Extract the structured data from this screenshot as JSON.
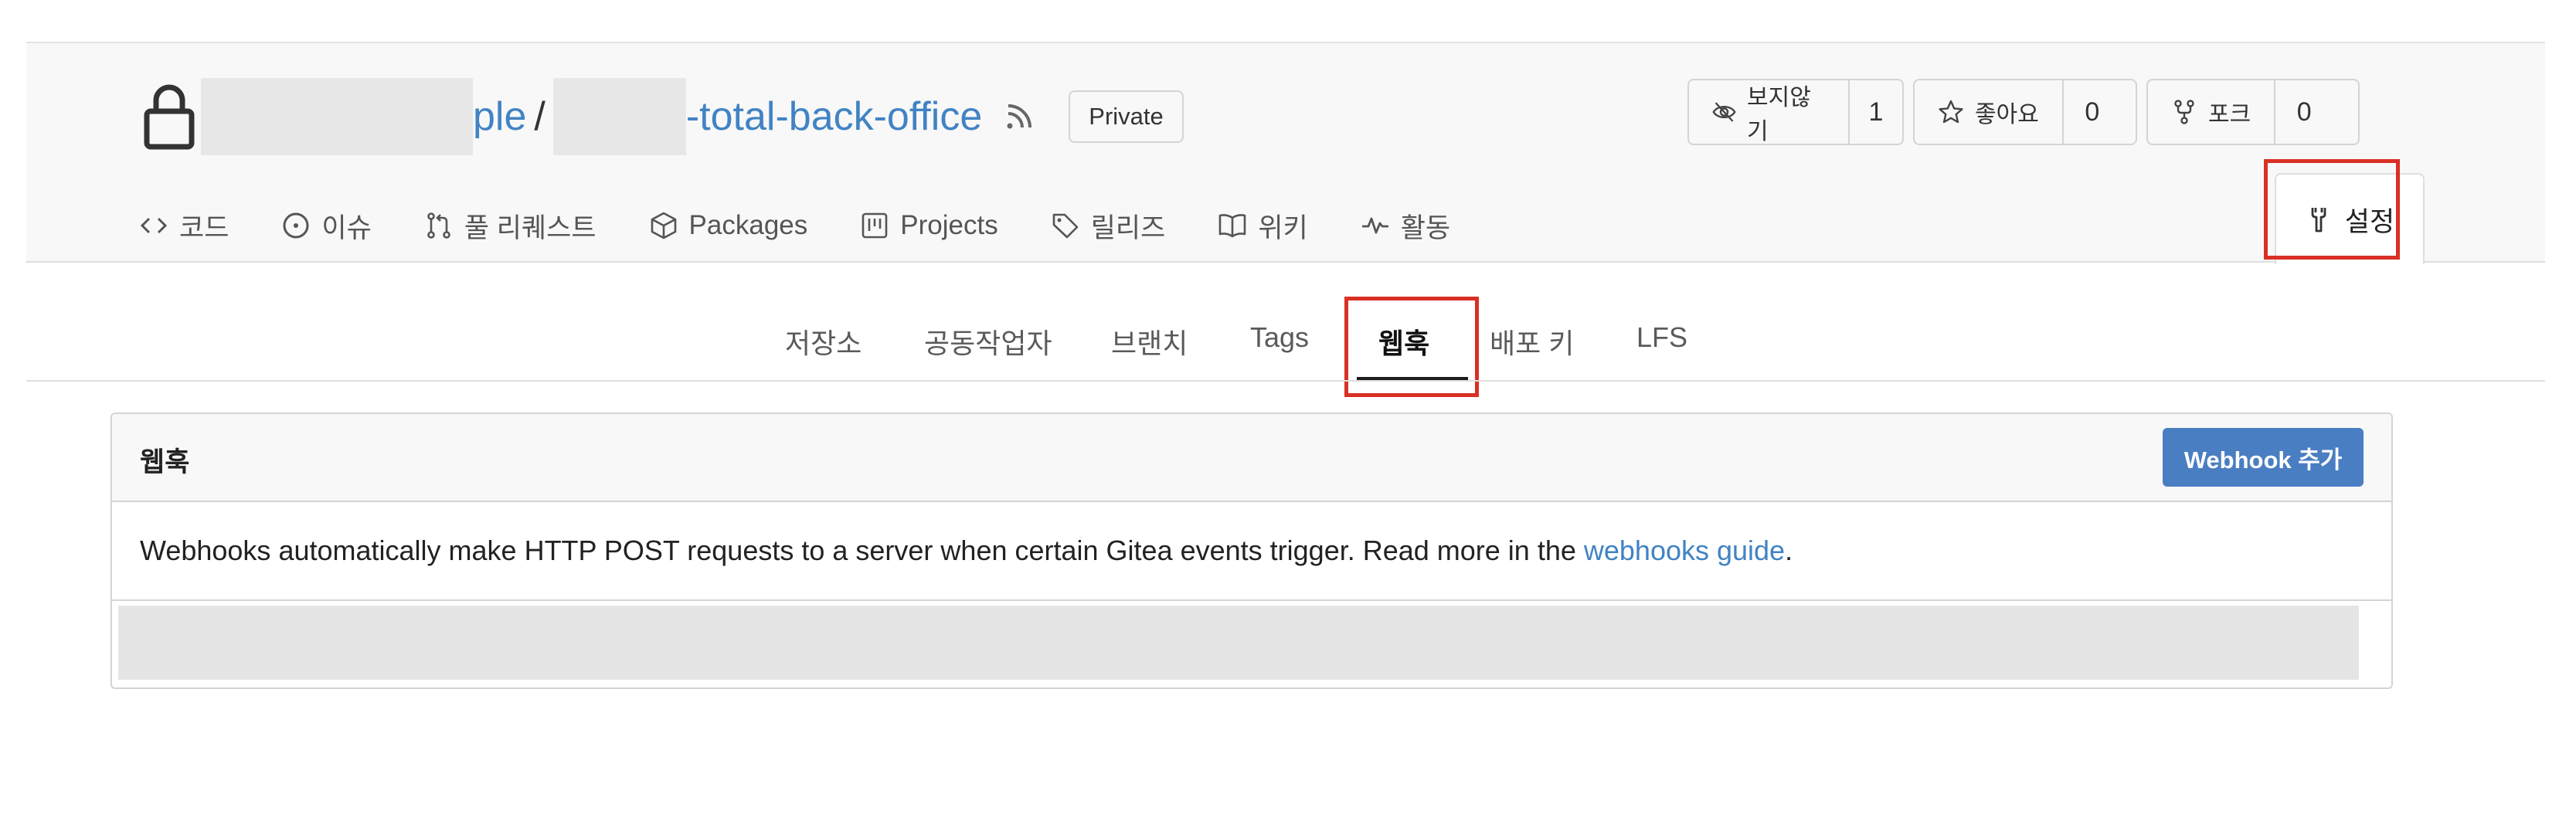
{
  "repo": {
    "owner_fragment": "ple",
    "separator": "/",
    "name_fragment": "-total-back-office",
    "badge": "Private"
  },
  "buttons": {
    "watch": {
      "label": "보지않기",
      "count": "1",
      "icon": "eye-off-icon"
    },
    "star": {
      "label": "좋아요",
      "count": "0",
      "icon": "star-icon"
    },
    "fork": {
      "label": "포크",
      "count": "0",
      "icon": "fork-icon"
    }
  },
  "tabs": [
    {
      "label": "코드",
      "icon": "code-icon"
    },
    {
      "label": "이슈",
      "icon": "issue-icon"
    },
    {
      "label": "풀 리퀘스트",
      "icon": "pull-request-icon"
    },
    {
      "label": "Packages",
      "icon": "package-icon"
    },
    {
      "label": "Projects",
      "icon": "project-icon"
    },
    {
      "label": "릴리즈",
      "icon": "tag-icon"
    },
    {
      "label": "위키",
      "icon": "book-icon"
    },
    {
      "label": "활동",
      "icon": "pulse-icon"
    }
  ],
  "settings_tab": {
    "label": "설정",
    "icon": "tools-icon"
  },
  "subnav": [
    "저장소",
    "공동작업자",
    "브랜치",
    "Tags",
    "웹훅",
    "배포 키",
    "LFS"
  ],
  "subnav_active": "웹훅",
  "panel": {
    "title": "웹훅",
    "add_button": "Webhook 추가",
    "description": "Webhooks automatically make HTTP POST requests to a server when certain Gitea events trigger. Read more in the ",
    "link_text": "webhooks guide",
    "description_end": "."
  },
  "colors": {
    "link": "#4183c4",
    "primary_button": "#4a7ec2",
    "highlight_box": "#d93025"
  }
}
